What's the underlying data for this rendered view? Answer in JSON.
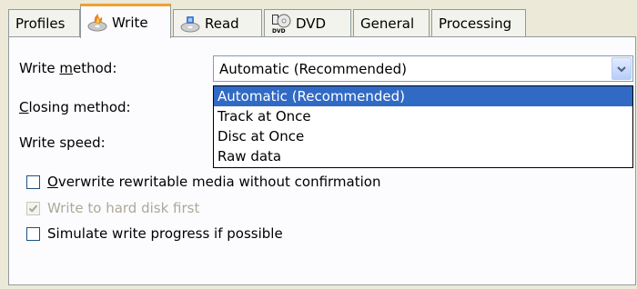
{
  "tabs": [
    {
      "label": "Profiles",
      "icon": "none"
    },
    {
      "label": "Write",
      "icon": "write-disc-icon",
      "active": true
    },
    {
      "label": "Read",
      "icon": "read-disc-icon"
    },
    {
      "label": "DVD",
      "icon": "dvd-icon"
    },
    {
      "label": "General",
      "icon": "none"
    },
    {
      "label": "Processing",
      "icon": "none"
    }
  ],
  "write": {
    "write_method_label_pre": "Write ",
    "write_method_label_key": "m",
    "write_method_label_post": "ethod:",
    "closing_method_label_key": "C",
    "closing_method_label_post": "losing method:",
    "write_speed_label": "Write speed:",
    "write_method_value": "Automatic (Recommended)",
    "write_method_options": [
      "Automatic (Recommended)",
      "Track at Once",
      "Disc at Once",
      "Raw data"
    ],
    "checkboxes": [
      {
        "label_key": "O",
        "label_post": "verwrite rewritable media without confirmation",
        "checked": false,
        "disabled": false
      },
      {
        "label_key": "",
        "label_post": "Write to hard disk first",
        "checked": true,
        "disabled": true
      },
      {
        "label_key": "",
        "label_post": "Simulate write progress if possible",
        "checked": false,
        "disabled": false
      }
    ]
  },
  "colors": {
    "selection": "#316ac5",
    "tab_active_accent": "#f0a030",
    "window_bg": "#ece9d8"
  }
}
